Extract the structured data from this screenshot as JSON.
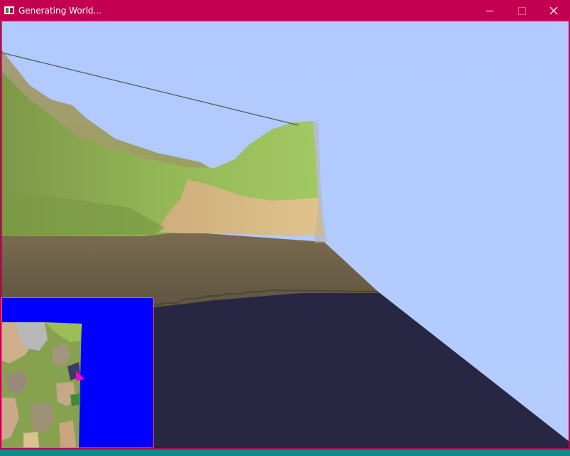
{
  "window": {
    "title": "Generating World...",
    "icons": [
      "app-icon",
      "minimize-icon",
      "maximize-icon",
      "close-icon"
    ],
    "title_bar_color": "#c3004f"
  },
  "scene": {
    "sky_color": "#b2cbff",
    "shadow_color": "#272643",
    "grass_color": "#9fc65e",
    "sand_color": "#d8b984",
    "dirt_color": "#6f6248"
  },
  "minimap": {
    "background_color": "#0000ff",
    "border_color": "#ff4f8e",
    "player_marker_color": "#ff00c8"
  }
}
